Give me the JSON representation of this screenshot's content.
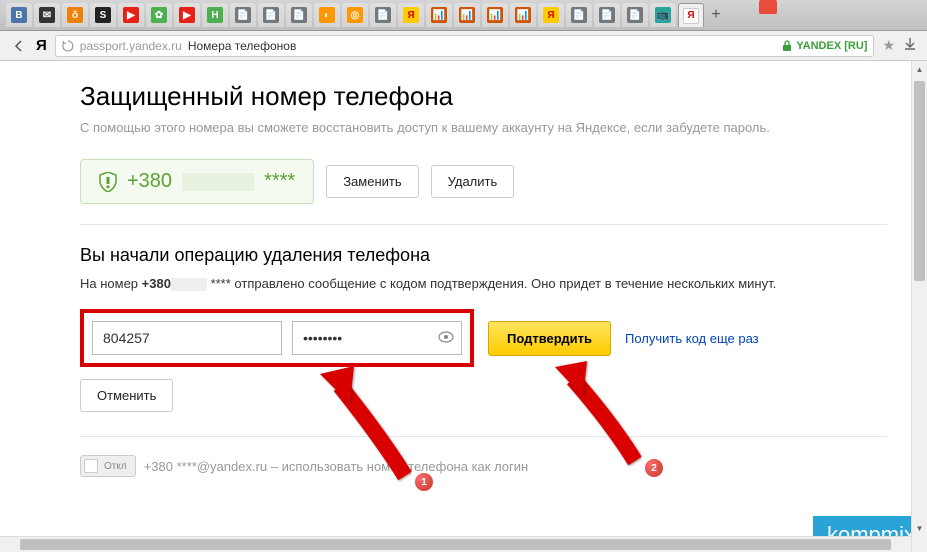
{
  "browser": {
    "url": "passport.yandex.ru",
    "breadcrumb": "Номера телефонов",
    "ssl_label": "YANDEX [RU]",
    "plus_label": "+"
  },
  "page": {
    "title": "Защищенный номер телефона",
    "subtitle": "С помощью этого номера вы сможете восстановить доступ к вашему аккаунту на Яндексе, если забудете пароль."
  },
  "phone_box": {
    "number_prefix": "+380",
    "number_mask": "****",
    "change_label": "Заменить",
    "delete_label": "Удалить"
  },
  "operation": {
    "title": "Вы начали операцию удаления телефона",
    "desc_pre": "На номер ",
    "desc_num": "+380",
    "desc_mask": " **** ",
    "desc_post": "отправлено сообщение с кодом подтверждения. Оно придет в течение нескольких минут."
  },
  "form": {
    "code_value": "804257",
    "password_value": "••••••••",
    "confirm_label": "Подтвердить",
    "resend_label": "Получить код еще раз",
    "cancel_label": "Отменить"
  },
  "login_row": {
    "toggle_label": "Откл",
    "text_prefix": "+380",
    "text_mask": " ****",
    "text_suffix": "@yandex.ru – использовать номер телефона как логин"
  },
  "watermark": "kompmix",
  "annotations": {
    "badge1": "1",
    "badge2": "2"
  }
}
